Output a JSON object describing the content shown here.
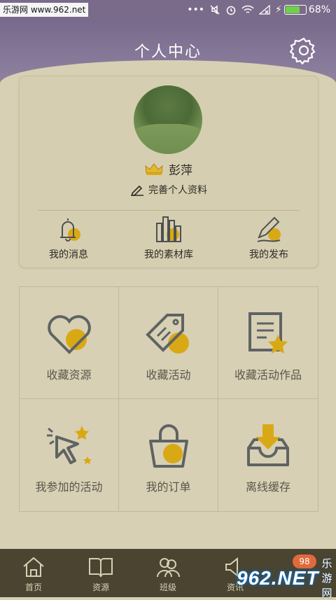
{
  "status_bar": {
    "site_tag": "乐游网 www.962.net",
    "battery": "68%",
    "battery_level": 0.68
  },
  "header": {
    "title": "个人中心",
    "settings_icon": "gear-icon"
  },
  "profile": {
    "name": "彭萍",
    "edit_label": "完善个人资料"
  },
  "quick_links": [
    {
      "label": "我的消息",
      "icon": "bell-icon"
    },
    {
      "label": "我的素材库",
      "icon": "library-icon"
    },
    {
      "label": "我的发布",
      "icon": "pen-icon"
    }
  ],
  "grid": [
    {
      "label": "收藏资源",
      "icon": "heart-icon"
    },
    {
      "label": "收藏活动",
      "icon": "tag-icon"
    },
    {
      "label": "收藏活动作品",
      "icon": "document-star-icon"
    },
    {
      "label": "我参加的活动",
      "icon": "megaphone-icon"
    },
    {
      "label": "我的订单",
      "icon": "shopping-bag-icon"
    },
    {
      "label": "离线缓存",
      "icon": "download-tray-icon"
    }
  ],
  "tabbar": {
    "items": [
      {
        "label": "首页",
        "icon": "home-icon"
      },
      {
        "label": "资源",
        "icon": "book-icon"
      },
      {
        "label": "班级",
        "icon": "people-icon"
      },
      {
        "label": "资讯",
        "icon": "speaker-icon"
      },
      {
        "label": "",
        "icon": ""
      }
    ],
    "badge": "98"
  },
  "watermark": {
    "logo": "962.NET",
    "text": "乐游网"
  },
  "colors": {
    "accent": "#d9a915",
    "header": "#7a6b8b",
    "tabbar": "#4a4431",
    "background": "#d8d0b4"
  }
}
